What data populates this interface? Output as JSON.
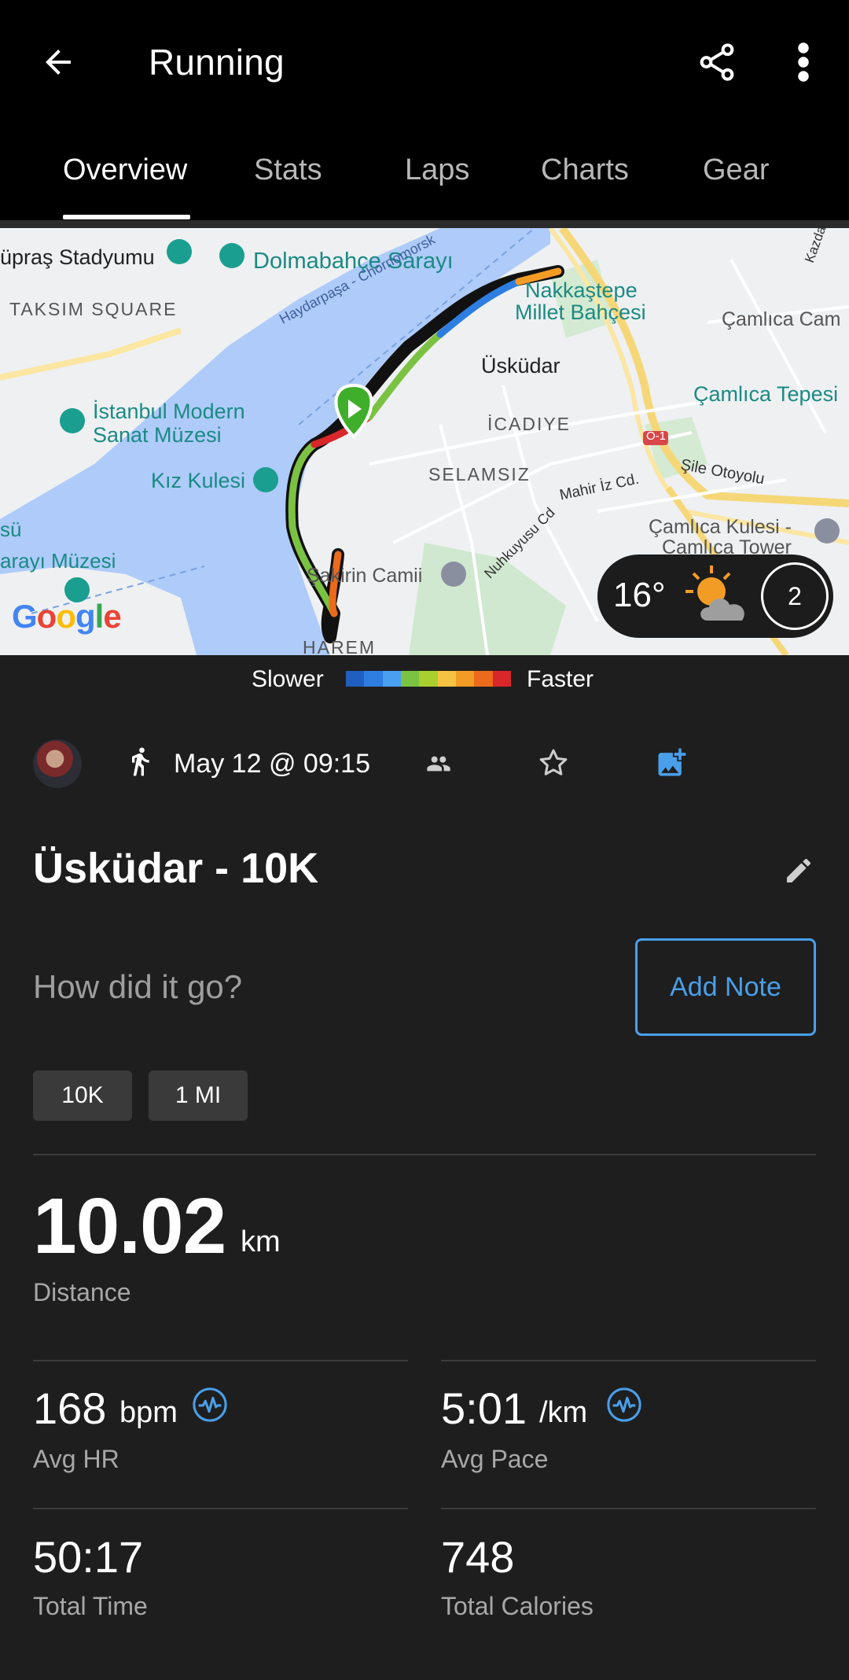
{
  "header": {
    "title": "Running"
  },
  "tabs": [
    {
      "label": "Overview",
      "active": true
    },
    {
      "label": "Stats"
    },
    {
      "label": "Laps"
    },
    {
      "label": "Charts"
    },
    {
      "label": "Gear"
    }
  ],
  "map": {
    "labels": {
      "stadium": "üpraş Stadyumu",
      "palace": "Dolmabahçe Sarayı",
      "taksim": "TAKSIM SQUARE",
      "bosphorus": "Haydarpaşa - Chornomorsk",
      "istanbul_modern_1": "İstanbul Modern",
      "istanbul_modern_2": "Sanat Müzesi",
      "kiz_kulesi": "Kız Kulesi",
      "uskudar": "Üsküdar",
      "icadiye": "İCADIYE",
      "selamsiz": "SELAMSIZ",
      "nakkastepe_1": "Nakkaştepe",
      "nakkastepe_2": "Millet Bahçesi",
      "camlica_cam": "Çamlıca Cam",
      "camlica_tepesi": "Çamlıca Tepesi",
      "o1": "O-1",
      "sile": "Şile Otoyolu",
      "mahir": "Mahir İz Cd.",
      "nuhkuyusu": "Nuhkuyusu Cd",
      "camlica_kulesi_1": "Çamlıca Kulesi -",
      "camlica_kulesi_2": "Camlıca Tower",
      "sakirin": "Şakirin Camii",
      "saray_muzesi": "arayı Müzesi",
      "su": "sü",
      "harem": "HAREM",
      "kazdal": "Kazdal C",
      "google": "Google"
    },
    "weather": {
      "temperature": "16°",
      "moon_phase": "2"
    }
  },
  "legend": {
    "slower": "Slower",
    "faster": "Faster",
    "colors": [
      "#1f5fbf",
      "#2d7ee0",
      "#4aa0f0",
      "#7cc242",
      "#a8cf2e",
      "#f5c242",
      "#f39c25",
      "#ec6a1c",
      "#d9262a"
    ]
  },
  "activity": {
    "date": "May 12 @ 09:15",
    "title": "Üsküdar - 10K",
    "note_prompt": "How did it go?",
    "add_note": "Add Note",
    "chips": [
      "10K",
      "1 MI"
    ]
  },
  "stats": {
    "distance": {
      "value": "10.02",
      "unit": "km",
      "label": "Distance"
    },
    "avg_hr": {
      "value": "168",
      "unit": "bpm",
      "label": "Avg HR"
    },
    "avg_pace": {
      "value": "5:01",
      "unit": "/km",
      "label": "Avg Pace"
    },
    "total_time": {
      "value": "50:17",
      "label": "Total Time"
    },
    "total_calories": {
      "value": "748",
      "label": "Total Calories"
    }
  },
  "icons": [
    "back-arrow-icon",
    "share-icon",
    "more-vert-icon",
    "run-icon",
    "people-icon",
    "star-icon",
    "add-photo-icon",
    "edit-icon",
    "pulse-icon"
  ]
}
